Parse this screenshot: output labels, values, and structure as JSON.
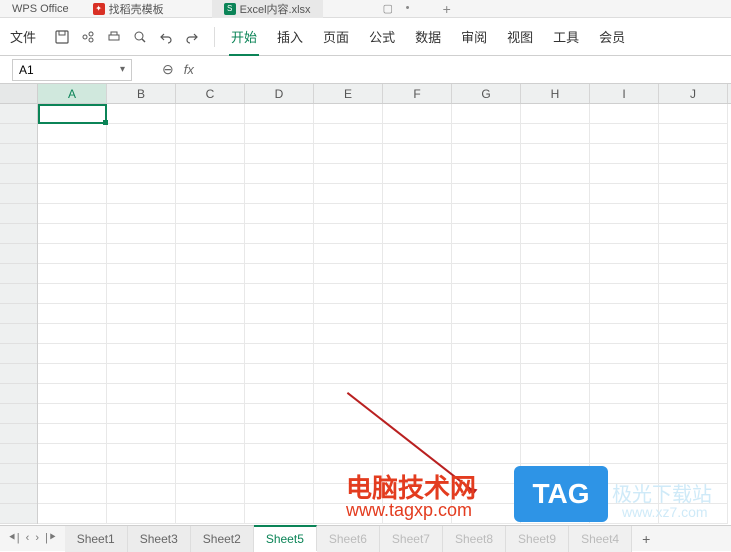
{
  "titleTabs": {
    "app": "WPS Office",
    "template": "找稻壳模板",
    "doc": "Excel内容.xlsx"
  },
  "menus": {
    "file": "文件",
    "start": "开始",
    "insert": "插入",
    "page": "页面",
    "formula": "公式",
    "data": "数据",
    "review": "审阅",
    "view": "视图",
    "tools": "工具",
    "member": "会员"
  },
  "namebox": {
    "ref": "A1"
  },
  "columns": [
    "A",
    "B",
    "C",
    "D",
    "E",
    "F",
    "G",
    "H",
    "I",
    "J"
  ],
  "sheets": {
    "items": [
      "Sheet1",
      "Sheet3",
      "Sheet2",
      "Sheet5",
      "Sheet6",
      "Sheet7",
      "Sheet8",
      "Sheet9",
      "Sheet4"
    ],
    "active": "Sheet5"
  },
  "watermarks": {
    "red_title": "电脑技术网",
    "red_url": "www.tagxp.com",
    "tag": "TAG",
    "blue_title": "极光下载站",
    "blue_url": "www.xz7.com"
  }
}
